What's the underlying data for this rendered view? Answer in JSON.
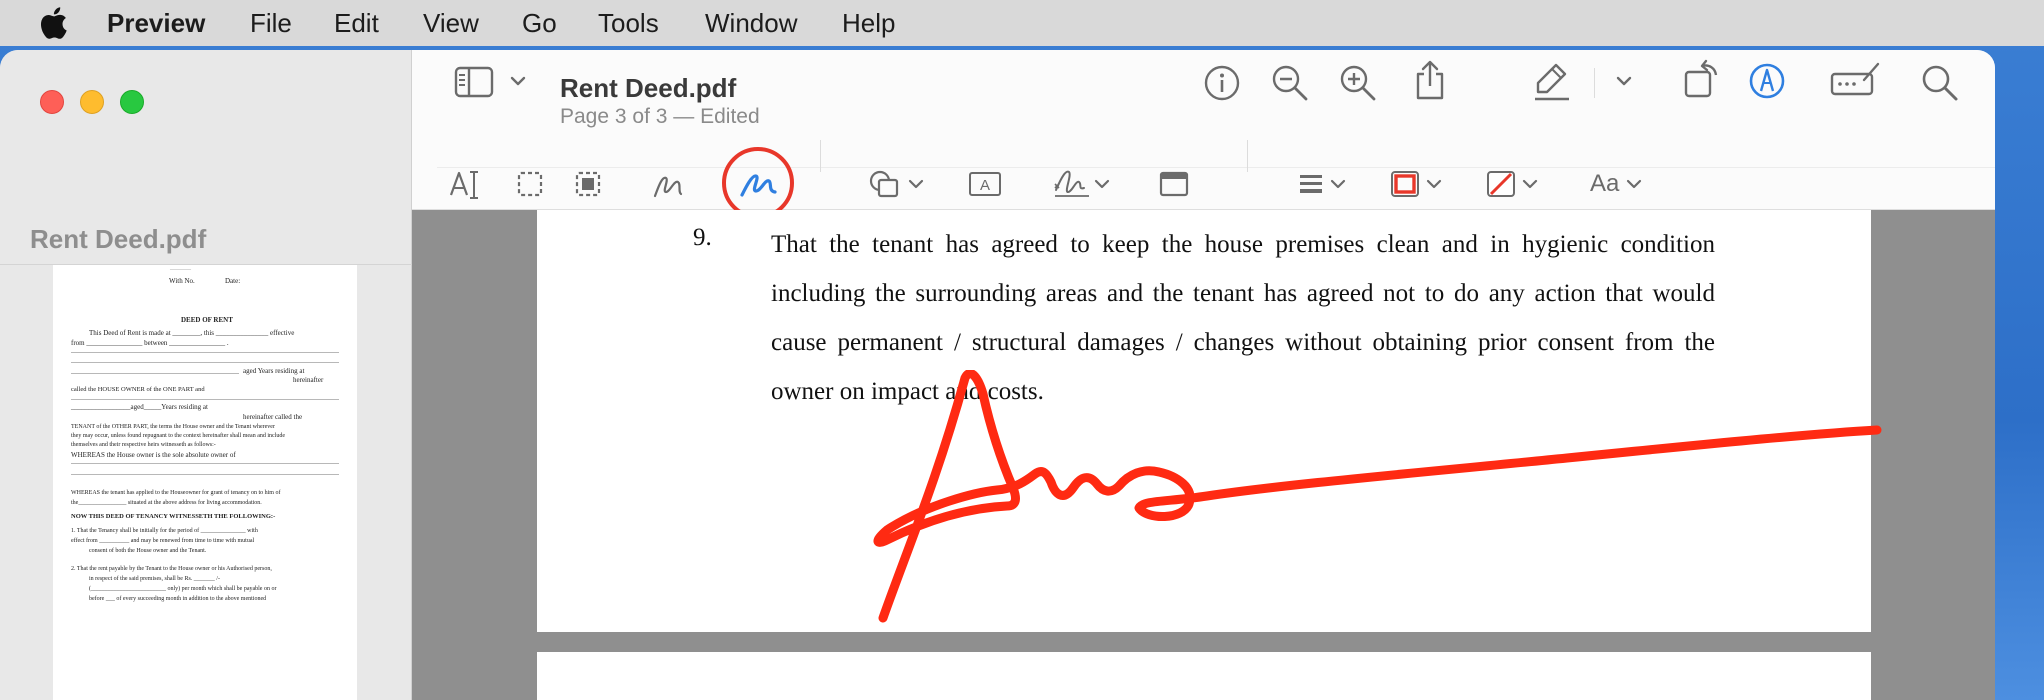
{
  "menubar": {
    "app_name": "Preview",
    "items": [
      "File",
      "Edit",
      "View",
      "Go",
      "Tools",
      "Window",
      "Help"
    ]
  },
  "window": {
    "title": "Rent Deed.pdf",
    "subtitle": "Page 3 of 3 — Edited"
  },
  "sidebar": {
    "doc_name": "Rent Deed.pdf",
    "thumbnail": {
      "line_with_no": "With No.",
      "line_date": "Date:",
      "heading": "DEED OF RENT",
      "lines": [
        "This Deed of Rent is made at ________, this _______________ effective",
        "from ________________ between ________________ .",
        "aged Years residing at",
        "hereinafter",
        "called the HOUSE OWNER of the ONE PART and",
        "_________________aged_____Years residing at",
        "hereinafter called the",
        "TENANT of the OTHER PART, the terms the House owner and the Tenant wherever",
        "they may occur, unless found repugnant to the context hereinafter shall mean and include",
        "themselves and their respective heirs witnesseth as follows:-",
        "WHEREAS the House owner is the sole absolute owner of",
        "WHEREAS the tenant has applied to the Houseowner for grant of tenancy on to him of",
        "the________________ situated at the above address for living accommodation.",
        "NOW THIS DEED OF TENANCY WITNESSETH THE FOLLOWING:-",
        "1. That the Tenancy shall be initially for the period of _______________ with",
        "effect from __________ and may be renewed from time to time with mutual",
        "consent of both the House owner and the Tenant.",
        "2. That the rent payable by the Tenant to the House owner or his Authorised person,",
        "in respect of the said premises, shall be Rs. _______ /-",
        "(_________________________ only) per month which shall be payable on or",
        "before ___ of every succeeding month in addition to the above mentioned"
      ]
    }
  },
  "toolbar": {
    "row1_icons": [
      "sidebar-toggle-icon",
      "chevron-down-icon",
      "info-icon",
      "zoom-out-icon",
      "zoom-in-icon",
      "share-icon",
      "highlight-icon",
      "chevron-down-icon",
      "rotate-icon",
      "markup-icon",
      "form-fill-icon",
      "search-icon"
    ],
    "row2_icons": [
      "text-selection-icon",
      "rectangular-selection-icon",
      "smart-lasso-icon",
      "sketch-icon",
      "draw-icon",
      "shapes-icon",
      "text-box-icon",
      "sign-icon",
      "note-icon",
      "shape-style-icon",
      "border-color-icon",
      "fill-color-icon",
      "text-style-icon"
    ],
    "text_style_label": "Aa",
    "text_box_label": "A",
    "active_tool": "draw",
    "active_tool_highlight_color": "#e8372a"
  },
  "document": {
    "paragraph_number": "9.",
    "paragraph_text": "That the tenant has agreed to keep the house premises clean and in hygienic condition including the surrounding areas and the tenant  has agreed not to do any action that would cause permanent / structural damages / changes without obtaining prior consent from the owner  on impact and costs.",
    "signature_color": "#ff2a12"
  },
  "colors": {
    "accent": "#2f7fe0",
    "menubar_bg": "#d9d9d9",
    "page_bg": "#ffffff",
    "canvas_bg": "#8f8f8f"
  }
}
